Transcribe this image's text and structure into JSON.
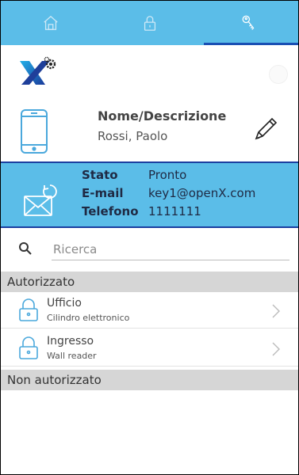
{
  "tabs": [
    {
      "name": "home-icon",
      "active": false
    },
    {
      "name": "lock-icon",
      "active": false
    },
    {
      "name": "key-icon",
      "active": true
    }
  ],
  "colors": {
    "accent": "#5bbde8",
    "indicator": "#1a4fb3",
    "section_header": "#d6d6d6"
  },
  "device": {
    "label": "Nome/Descrizione",
    "value": "Rossi, Paolo"
  },
  "status": {
    "state_label": "Stato",
    "state_value": "Pronto",
    "email_label": "E-mail",
    "email_value": "key1@openX.com",
    "phone_label": "Telefono",
    "phone_value": "1111111"
  },
  "search": {
    "placeholder": "Ricerca"
  },
  "authorized": {
    "header": "Autorizzato",
    "items": [
      {
        "title": "Ufficio",
        "subtitle": "Cilindro elettronico"
      },
      {
        "title": "Ingresso",
        "subtitle": "Wall reader"
      }
    ]
  },
  "unauthorized": {
    "header": "Non autorizzato"
  }
}
